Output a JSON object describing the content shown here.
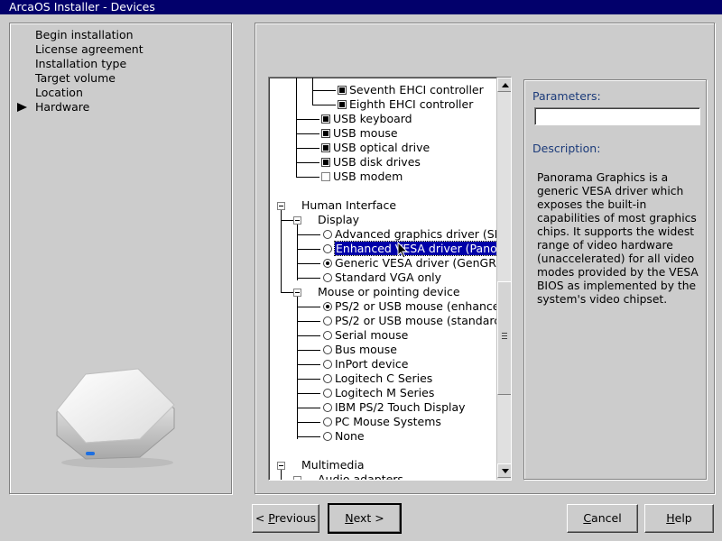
{
  "window": {
    "title": "ArcaOS Installer - Devices"
  },
  "steps": [
    {
      "label": "Begin installation",
      "current": false
    },
    {
      "label": "License agreement",
      "current": false
    },
    {
      "label": "Installation type",
      "current": false
    },
    {
      "label": "Target volume",
      "current": false
    },
    {
      "label": "Location",
      "current": false
    },
    {
      "label": "Hardware",
      "current": true
    }
  ],
  "tree": {
    "usb_items": [
      {
        "label": "Seventh EHCI controller",
        "checked": true
      },
      {
        "label": "Eighth EHCI controller",
        "checked": true
      },
      {
        "label": "USB keyboard",
        "checked": true
      },
      {
        "label": "USB mouse",
        "checked": true
      },
      {
        "label": "USB optical drive",
        "checked": true
      },
      {
        "label": "USB disk drives",
        "checked": true
      },
      {
        "label": "USB modem",
        "checked": false
      }
    ],
    "human_interface": "Human Interface",
    "display": "Display",
    "display_options": [
      {
        "label": "Advanced graphics driver (SN",
        "selected": false
      },
      {
        "label": "Enhanced VESA driver (Panor",
        "selected": false,
        "highlighted": true
      },
      {
        "label": "Generic VESA driver (GenGR",
        "selected": true
      },
      {
        "label": "Standard VGA only",
        "selected": false
      }
    ],
    "mouse": "Mouse or pointing device",
    "mouse_options": [
      {
        "label": "PS/2 or USB mouse (enhance",
        "selected": true
      },
      {
        "label": "PS/2 or USB mouse (standarc",
        "selected": false
      },
      {
        "label": "Serial mouse",
        "selected": false
      },
      {
        "label": "Bus mouse",
        "selected": false
      },
      {
        "label": "InPort device",
        "selected": false
      },
      {
        "label": "Logitech C Series",
        "selected": false
      },
      {
        "label": "Logitech M Series",
        "selected": false
      },
      {
        "label": "IBM PS/2 Touch Display",
        "selected": false
      },
      {
        "label": "PC Mouse Systems",
        "selected": false
      },
      {
        "label": "None",
        "selected": false
      }
    ],
    "multimedia": "Multimedia",
    "audio": "Audio adapters"
  },
  "parameters": {
    "label": "Parameters:",
    "value": ""
  },
  "description": {
    "label": "Description:",
    "text": "Panorama Graphics is a generic VESA driver which exposes the built-in capabilities of most graphics chips. It supports the widest range of video hardware (unaccelerated) for all video modes provided by the VESA BIOS as implemented by the system's video chipset."
  },
  "buttons": {
    "previous": {
      "mnemonic": "P",
      "rest": "revious",
      "prefix": "< "
    },
    "next": {
      "mnemonic": "N",
      "rest": "ext >"
    },
    "cancel": {
      "mnemonic": "C",
      "rest": "ancel"
    },
    "help": {
      "mnemonic": "H",
      "rest": "elp"
    }
  },
  "colors": {
    "titlebar": "#02006b",
    "selection": "#0000a8",
    "accent_label": "#1c3b7a"
  }
}
